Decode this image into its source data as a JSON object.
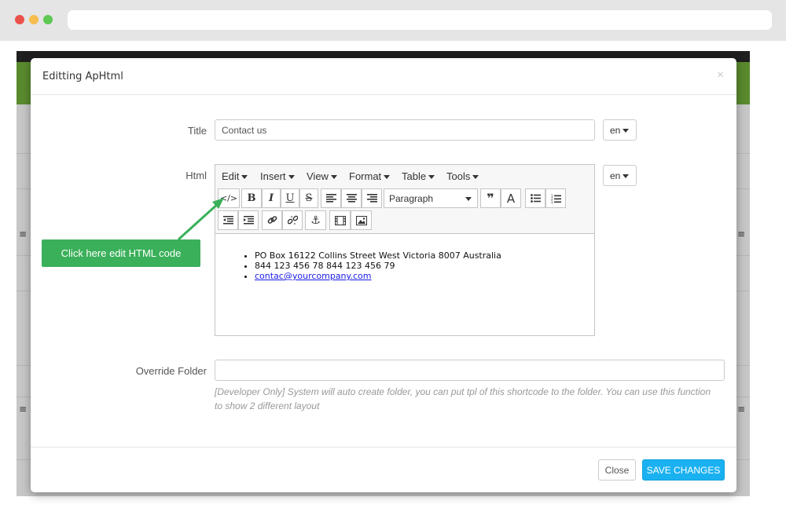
{
  "modal": {
    "title": "Editting ApHtml",
    "close_symbol": "×"
  },
  "form": {
    "title_label": "Title",
    "title_value": "Contact us",
    "html_label": "Html",
    "override_label": "Override Folder",
    "override_value": "",
    "help_text": "[Developer Only] System will auto create folder, you can put tpl of this shortcode to the folder. You can use this function to show 2 different layout",
    "lang_value": "en"
  },
  "editor": {
    "menus": [
      "Edit",
      "Insert",
      "View",
      "Format",
      "Table",
      "Tools"
    ],
    "toolbar": {
      "code_icon": "</>",
      "bold": "B",
      "italic": "I",
      "underline": "U",
      "strike": "S",
      "format_select": "Paragraph",
      "blockquote": "❞",
      "textcolor": "A"
    },
    "content_items": [
      "PO Box 16122 Collins Street West Victoria 8007 Australia",
      " 844 123 456 78 844 123 456 79",
      " contac@yourcompany.com"
    ]
  },
  "footer": {
    "close_label": "Close",
    "save_label": "SAVE CHANGES"
  },
  "callout": {
    "text": "Click here edit HTML code"
  },
  "colors": {
    "accent_blue": "#1ab1f0",
    "callout_green": "#3ab05a",
    "header_green": "#5a8a2e"
  }
}
